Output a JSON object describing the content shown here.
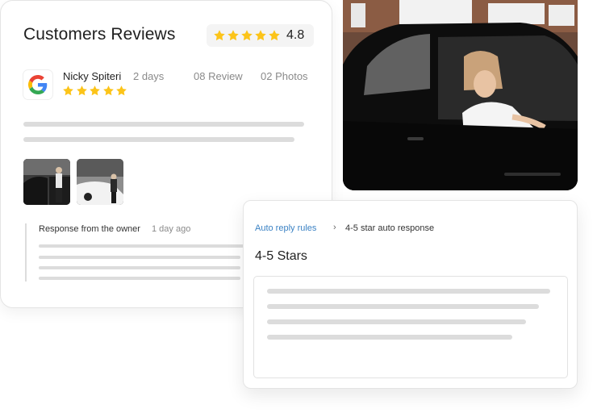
{
  "review_card": {
    "title": "Customers Reviews",
    "rating_value": "4.8",
    "rating_stars": 4.8,
    "reviewer": {
      "name": "Nicky Spiteri",
      "stars": 5,
      "time_ago": "2 days",
      "review_count": "08 Review",
      "photo_count": "02 Photos"
    },
    "owner_response": {
      "label": "Response from the owner",
      "time_ago": "1 day ago"
    }
  },
  "rules_card": {
    "breadcrumb_link": "Auto reply rules",
    "breadcrumb_separator": "›",
    "breadcrumb_current": "4-5 star auto response",
    "title": "4-5 Stars"
  },
  "colors": {
    "star": "#fcc419",
    "link": "#3b82c4",
    "skeleton": "#dcdcdc"
  }
}
